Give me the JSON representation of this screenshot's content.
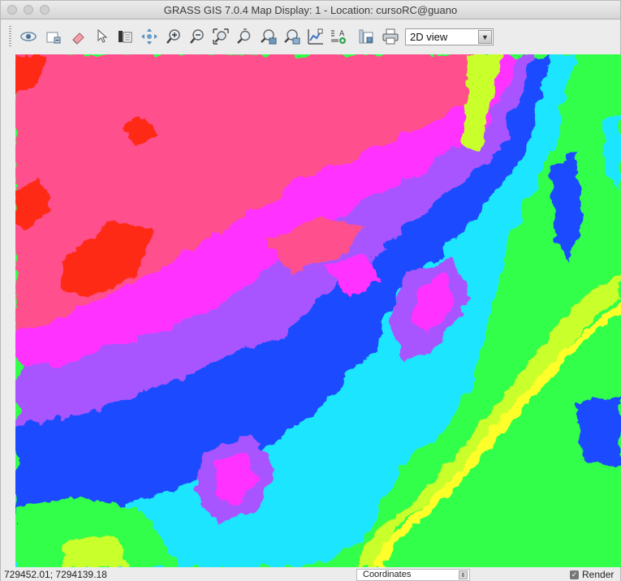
{
  "window": {
    "title": "GRASS GIS 7.0.4 Map Display: 1 - Location: cursoRC@guano"
  },
  "toolbar": {
    "tools": [
      {
        "name": "display-map-icon",
        "glyph": "eye"
      },
      {
        "name": "render-map-icon",
        "glyph": "render"
      },
      {
        "name": "erase-display-icon",
        "glyph": "erase"
      },
      {
        "name": "pointer-icon",
        "glyph": "pointer"
      },
      {
        "name": "query-raster-icon",
        "glyph": "query"
      },
      {
        "name": "pan-icon",
        "glyph": "pan"
      },
      {
        "name": "zoom-in-icon",
        "glyph": "zoomin"
      },
      {
        "name": "zoom-out-icon",
        "glyph": "zoomout"
      },
      {
        "name": "zoom-extent-icon",
        "glyph": "zoomextent"
      },
      {
        "name": "zoom-back-icon",
        "glyph": "zoomback"
      },
      {
        "name": "zoom-options-icon",
        "glyph": "zoomopts"
      },
      {
        "name": "zoom-menu-icon",
        "glyph": "zoommenu"
      },
      {
        "name": "analyze-icon",
        "glyph": "analyze"
      },
      {
        "name": "decoration-icon",
        "glyph": "decoration"
      },
      {
        "name": "save-display-icon",
        "glyph": "save"
      },
      {
        "name": "print-icon",
        "glyph": "print"
      }
    ],
    "view_mode": "2D view"
  },
  "statusbar": {
    "coordinates": "729452.01; 7294139.18",
    "mode": "Coordinates",
    "render_label": "Render",
    "render_checked": true
  },
  "palette": {
    "red": "#ff2a12",
    "pink": "#ff4f8c",
    "magenta": "#ff33ff",
    "violet": "#a855ff",
    "blue": "#1a4bff",
    "cyan": "#1fe6ff",
    "green": "#33ff4a",
    "lime": "#c9ff2a",
    "yellow": "#fcff2a"
  }
}
